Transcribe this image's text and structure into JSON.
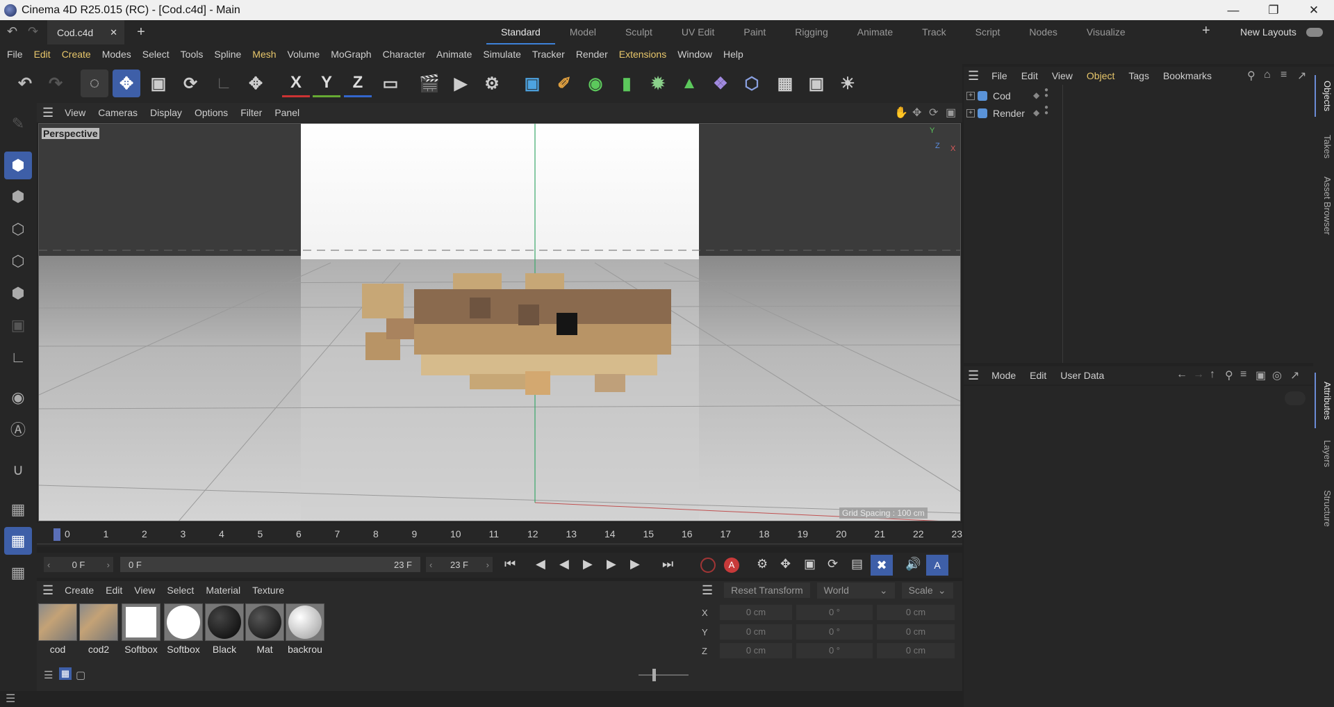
{
  "window": {
    "title": "Cinema 4D R25.015 (RC) - [Cod.c4d] - Main"
  },
  "doc_tab": {
    "label": "Cod.c4d"
  },
  "layouts": [
    "Standard",
    "Model",
    "Sculpt",
    "UV Edit",
    "Paint",
    "Rigging",
    "Animate",
    "Track",
    "Script",
    "Nodes",
    "Visualize"
  ],
  "new_layouts": "New Layouts",
  "menu": [
    "File",
    "Edit",
    "Create",
    "Modes",
    "Select",
    "Tools",
    "Spline",
    "Mesh",
    "Volume",
    "MoGraph",
    "Character",
    "Animate",
    "Simulate",
    "Tracker",
    "Render",
    "Extensions",
    "Window",
    "Help"
  ],
  "axis_labels": {
    "x": "X",
    "y": "Y",
    "z": "Z"
  },
  "viewport_menu": [
    "View",
    "Cameras",
    "Display",
    "Options",
    "Filter",
    "Panel"
  ],
  "viewport": {
    "camera_label": "Perspective",
    "grid_spacing": "Grid Spacing : 100 cm",
    "gizmo_x": "X",
    "gizmo_y": "Y",
    "gizmo_z": "Z"
  },
  "timeline": {
    "ticks": [
      "0",
      "1",
      "2",
      "3",
      "4",
      "5",
      "6",
      "7",
      "8",
      "9",
      "10",
      "11",
      "12",
      "13",
      "14",
      "15",
      "16",
      "17",
      "18",
      "19",
      "20",
      "21",
      "22",
      "23"
    ]
  },
  "transport": {
    "current_frame": "0 F",
    "range_start": "0 F",
    "range_end": "23 F",
    "end_frame": "23 F"
  },
  "material_menu": [
    "Create",
    "Edit",
    "View",
    "Select",
    "Material",
    "Texture"
  ],
  "materials": [
    "cod",
    "cod2",
    "Softbox",
    "Softbox",
    "Black",
    "Mat",
    "backrou"
  ],
  "coords": {
    "reset": "Reset Transform",
    "space": "World",
    "mode": "Scale",
    "rows": [
      {
        "axis": "X",
        "pos": "0 cm",
        "rot": "0 °",
        "scale": "0 cm"
      },
      {
        "axis": "Y",
        "pos": "0 cm",
        "rot": "0 °",
        "scale": "0 cm"
      },
      {
        "axis": "Z",
        "pos": "0 cm",
        "rot": "0 °",
        "scale": "0 cm"
      }
    ]
  },
  "object_menu": [
    "File",
    "Edit",
    "View",
    "Object",
    "Tags",
    "Bookmarks"
  ],
  "objects": [
    {
      "name": "Cod"
    },
    {
      "name": "Render"
    }
  ],
  "attr_menu": [
    "Mode",
    "Edit",
    "User Data"
  ],
  "side_tabs": [
    "Objects",
    "Takes",
    "Asset Browser",
    "Attributes",
    "Layers",
    "Structure"
  ]
}
